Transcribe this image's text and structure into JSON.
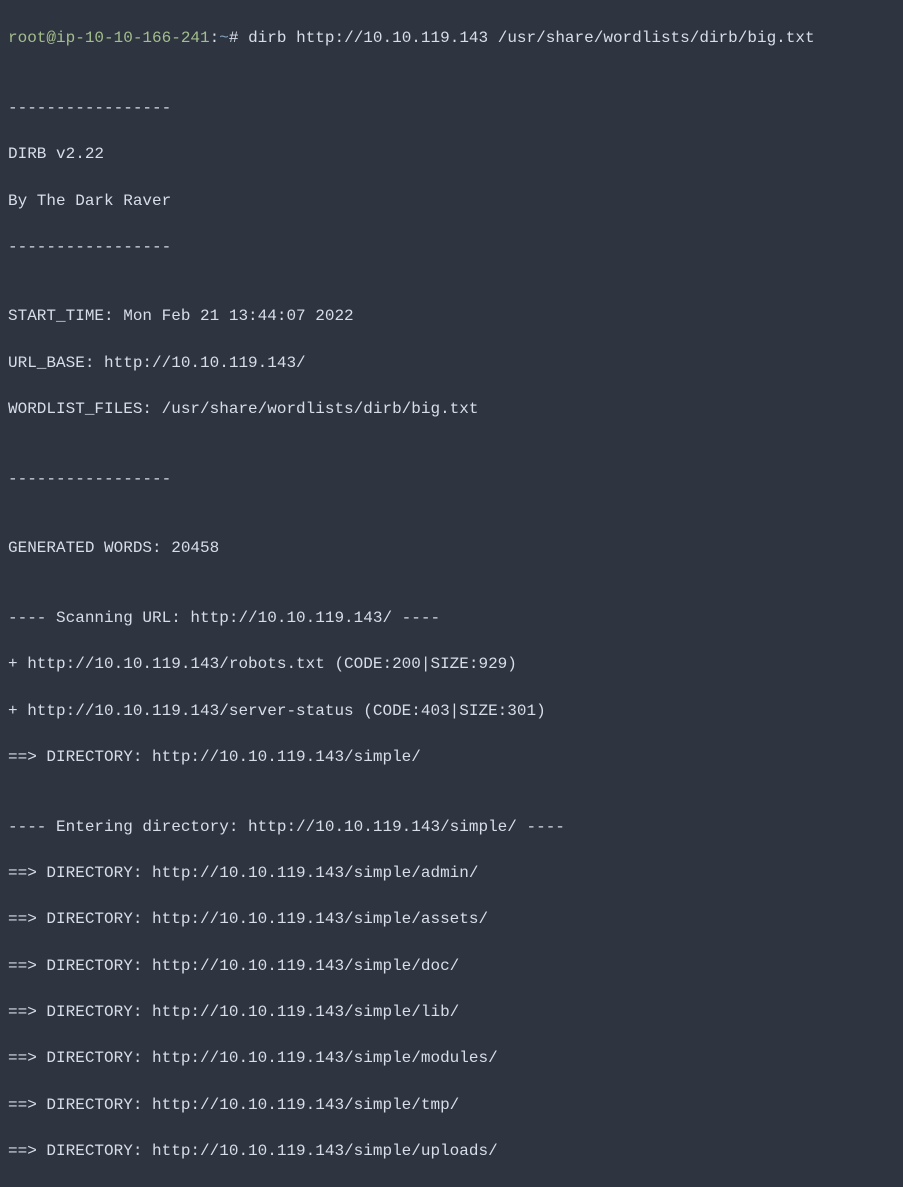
{
  "prompt": {
    "user_host": "root@ip-10-10-166-241",
    "separator": ":",
    "path": "~",
    "symbol": "#"
  },
  "command": "dirb http://10.10.119.143 /usr/share/wordlists/dirb/big.txt",
  "output": {
    "sep1": "-----------------",
    "title": "DIRB v2.22",
    "author": "By The Dark Raver",
    "sep2": "-----------------",
    "start_time": "START_TIME: Mon Feb 21 13:44:07 2022",
    "url_base": "URL_BASE: http://10.10.119.143/",
    "wordlist": "WORDLIST_FILES: /usr/share/wordlists/dirb/big.txt",
    "sep3": "-----------------",
    "gen_words": "GENERATED WORDS: 20458",
    "scan_url": "---- Scanning URL: http://10.10.119.143/ ----",
    "found1": "+ http://10.10.119.143/robots.txt (CODE:200|SIZE:929)",
    "found2": "+ http://10.10.119.143/server-status (CODE:403|SIZE:301)",
    "dir1": "==> DIRECTORY: http://10.10.119.143/simple/",
    "entering": "---- Entering directory: http://10.10.119.143/simple/ ----",
    "dir2": "==> DIRECTORY: http://10.10.119.143/simple/admin/",
    "dir3": "==> DIRECTORY: http://10.10.119.143/simple/assets/",
    "dir4": "==> DIRECTORY: http://10.10.119.143/simple/doc/",
    "dir5": "==> DIRECTORY: http://10.10.119.143/simple/lib/",
    "dir6": "==> DIRECTORY: http://10.10.119.143/simple/modules/",
    "dir7": "==> DIRECTORY: http://10.10.119.143/simple/tmp/",
    "dir8": "==> DIRECTORY: http://10.10.119.143/simple/uploads/"
  }
}
